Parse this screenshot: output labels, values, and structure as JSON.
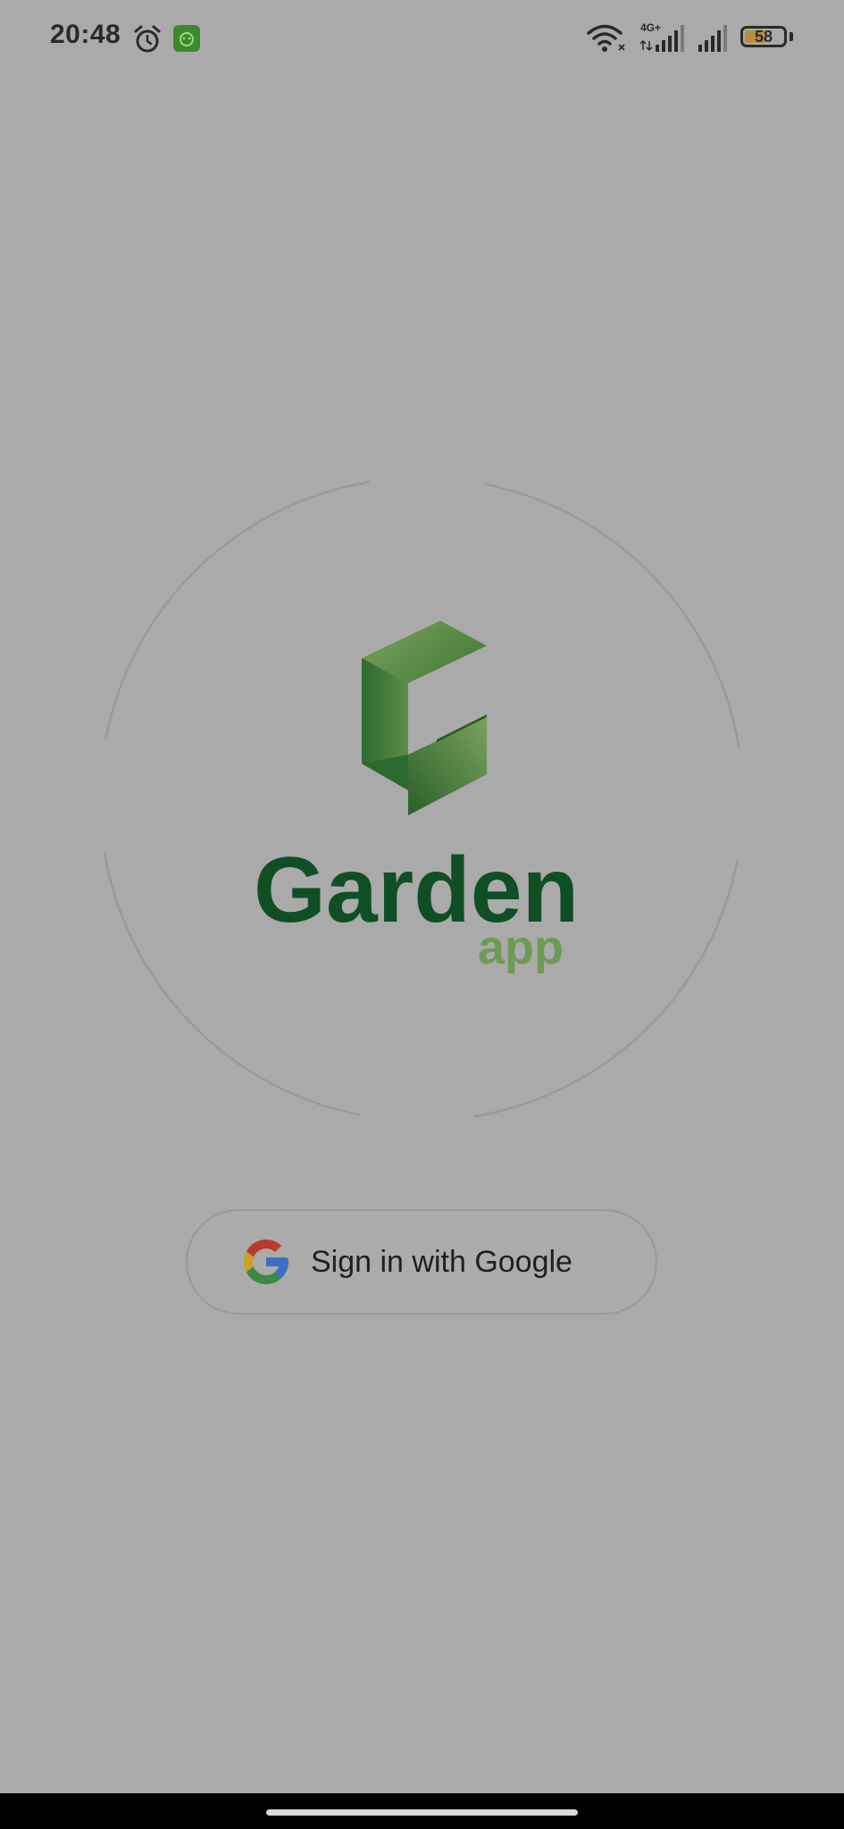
{
  "status_bar": {
    "time": "20:48",
    "network_label": "4G+",
    "battery_percent": "58",
    "battery_level": 0.58,
    "icons": [
      "alarm-icon",
      "app-notification-icon",
      "wifi-icon",
      "cell-signal-icon",
      "cell-signal-icon",
      "battery-icon"
    ]
  },
  "logo": {
    "word": "Garden",
    "sub": "app",
    "colors": {
      "word": "#104f24",
      "sub": "#6e9a55",
      "mark_dark": "#2d6a30",
      "mark_light": "#6e9a55"
    }
  },
  "sign_in": {
    "label": "Sign in with Google",
    "icon": "google-logo-icon"
  },
  "background_color": "#aaaaaa"
}
